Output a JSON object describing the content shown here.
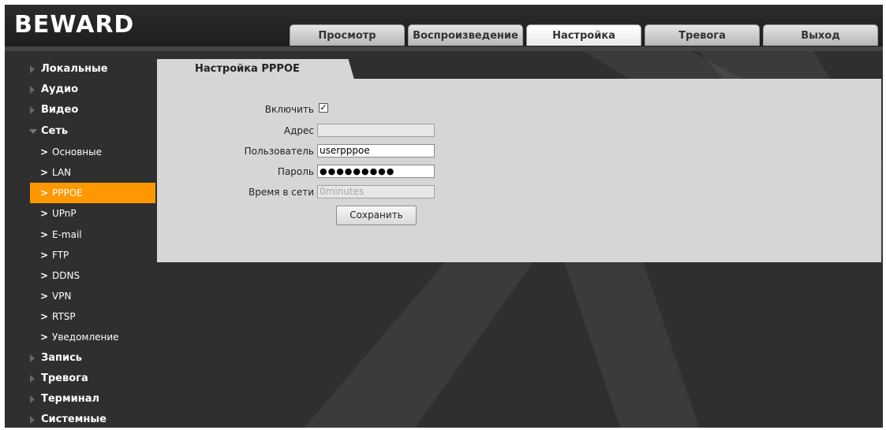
{
  "logo": "BEWARD",
  "tabs": [
    {
      "label": "Просмотр",
      "active": false
    },
    {
      "label": "Воспроизведение",
      "active": false
    },
    {
      "label": "Настройка",
      "active": true
    },
    {
      "label": "Тревога",
      "active": false
    },
    {
      "label": "Выход",
      "active": false
    }
  ],
  "sidebar": {
    "groups_top": [
      {
        "label": "Локальные"
      },
      {
        "label": "Аудио"
      },
      {
        "label": "Видео"
      }
    ],
    "network_group": {
      "label": "Сеть",
      "expanded": true
    },
    "network_items": [
      {
        "label": "Основные",
        "active": false
      },
      {
        "label": "LAN",
        "active": false
      },
      {
        "label": "PPPOE",
        "active": true
      },
      {
        "label": "UPnP",
        "active": false
      },
      {
        "label": "E-mail",
        "active": false
      },
      {
        "label": "FTP",
        "active": false
      },
      {
        "label": "DDNS",
        "active": false
      },
      {
        "label": "VPN",
        "active": false
      },
      {
        "label": "RTSP",
        "active": false
      },
      {
        "label": "Уведомление",
        "active": false
      }
    ],
    "groups_bottom": [
      {
        "label": "Запись"
      },
      {
        "label": "Тревога"
      },
      {
        "label": "Терминал"
      },
      {
        "label": "Системные"
      }
    ]
  },
  "panel": {
    "title": "Настройка PPPOE",
    "enable": {
      "label": "Включить",
      "checked": true,
      "mark": "✓"
    },
    "address": {
      "label": "Адрес",
      "value": ""
    },
    "user": {
      "label": "Пользователь",
      "value": "userpppoe"
    },
    "password": {
      "label": "Пароль",
      "value": "●●●●●●●●●"
    },
    "online_time": {
      "label": "Время в сети",
      "value": "0minutes"
    },
    "save_label": "Сохранить"
  },
  "colors": {
    "active_item": "#ff9800",
    "background": "#2f2f2f",
    "panel": "#d6d6d6"
  }
}
